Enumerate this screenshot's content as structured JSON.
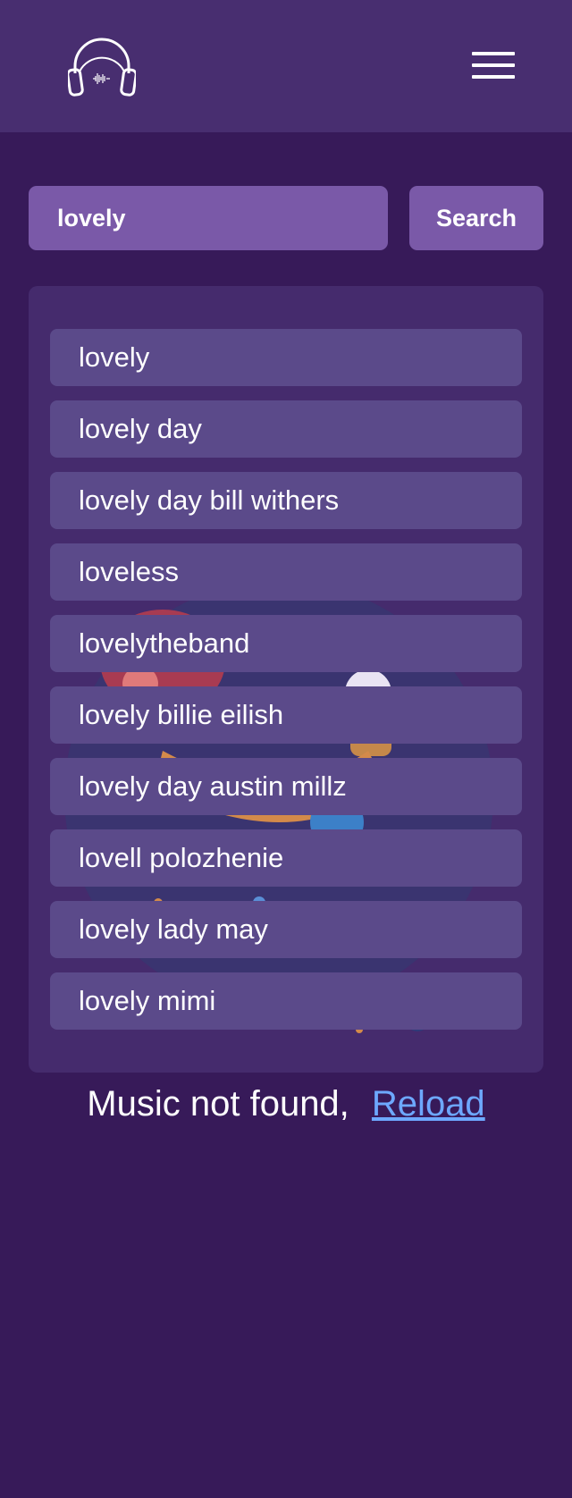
{
  "header": {
    "logo_icon": "headphones-icon",
    "menu_icon": "hamburger-menu-icon"
  },
  "search": {
    "value": "lovely",
    "button_label": "Search"
  },
  "suggestions": [
    "lovely",
    "lovely day",
    "lovely day bill withers",
    "loveless",
    "lovelytheband",
    "lovely billie eilish",
    "lovely day austin millz",
    "lovell polozhenie",
    "lovely lady may",
    "lovely mimi"
  ],
  "status": {
    "message": "Music not found,",
    "reload_label": "Reload"
  },
  "colors": {
    "background": "#371a59",
    "header": "#482e70",
    "input": "#7a59a8",
    "panel": "#452b6d",
    "item": "#5b4a8a",
    "link": "#6da8ff"
  }
}
